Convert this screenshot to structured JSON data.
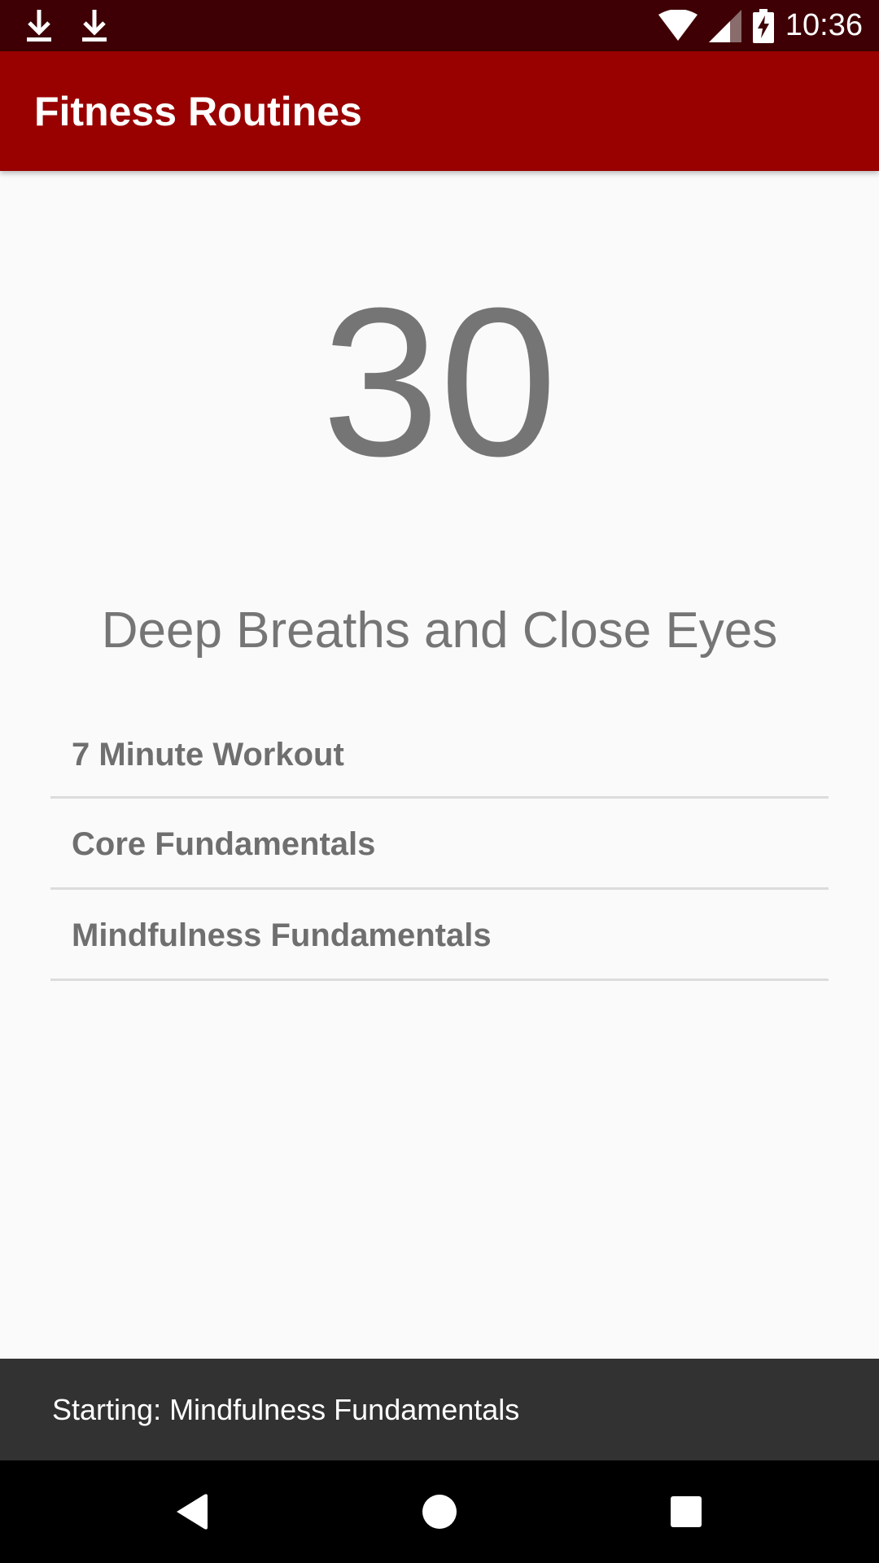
{
  "status_bar": {
    "time": "10:36",
    "left_icons": [
      "download-icon",
      "download-icon"
    ],
    "right_icons": [
      "wifi-icon",
      "signal-icon",
      "battery-charging-icon"
    ]
  },
  "app_bar": {
    "title": "Fitness Routines",
    "color": "#990000"
  },
  "timer": {
    "value": "30"
  },
  "instruction": {
    "text": "Deep Breaths and Close Eyes"
  },
  "routines": {
    "items": [
      {
        "label": "7 Minute Workout"
      },
      {
        "label": "Core Fundamentals"
      },
      {
        "label": "Mindfulness Fundamentals"
      }
    ]
  },
  "snackbar": {
    "text": "Starting: Mindfulness Fundamentals"
  },
  "nav_bar": {
    "buttons": [
      "back-icon",
      "home-icon",
      "recents-icon"
    ]
  }
}
